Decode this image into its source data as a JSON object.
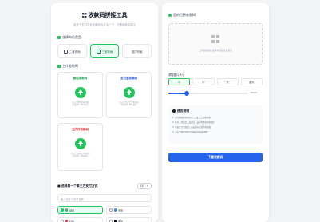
{
  "header": {
    "title": "收款码拼接工具",
    "subtitle": "将多个支付平台收款码合并为一个，方便收款和展示"
  },
  "layout": {
    "section_label": "选择布局类型",
    "options": [
      "二维布局",
      "三维布局",
      "竖排布局"
    ],
    "selected": "三维布局"
  },
  "upload": {
    "section_label": "上传收款码",
    "boxes": [
      {
        "label": "微信收款码",
        "hint": "点击上传微信收款码\n支持JPG, PNG格式",
        "color": "#16a34a"
      },
      {
        "label": "支付宝收款码",
        "hint": "点击上传支付宝收款码\n支持JPG, PNG格式",
        "color": "#1d4ed8"
      },
      {
        "label": "云闪付收款码",
        "hint": "点击上传云闪付收款码\n支持JPG, PNG格式",
        "color": "#dc2626"
      }
    ]
  },
  "third_party": {
    "label": "选择第一个第三方支付方式",
    "select_value": "QQ",
    "name_placeholder": "输入自定义支付名称",
    "colors": [
      {
        "label": "绿色",
        "swatch": "#22c55e",
        "selected": true
      },
      {
        "label": "蓝色",
        "swatch": "#3b82f6",
        "selected": false
      },
      {
        "label": "红色",
        "swatch": "#ef4444",
        "selected": false
      },
      {
        "label": "黑色",
        "swatch": "#111827",
        "selected": false
      }
    ]
  },
  "preview": {
    "section_label": "您的已拼收款码",
    "placeholder": "上传收款码并选择布局后生成预览"
  },
  "size": {
    "label": "调整图片大小",
    "options": [
      "小",
      "中",
      "大",
      "超大"
    ],
    "selected": "小",
    "slider_value": "300px",
    "slider_fraction": 0.23
  },
  "guide": {
    "title": "使用说明",
    "lines": [
      "1. 在左侧选择布局方式 (三维 / 二维或竖排)",
      "2. 依次上传微信、支付宝、云闪付等收款码图片",
      "3. 可自定义添加第三方支付方式及名称颜色",
      "4. 点击下载按钮保存拼接好的收款码图片"
    ]
  },
  "download_label": "下载收款码"
}
